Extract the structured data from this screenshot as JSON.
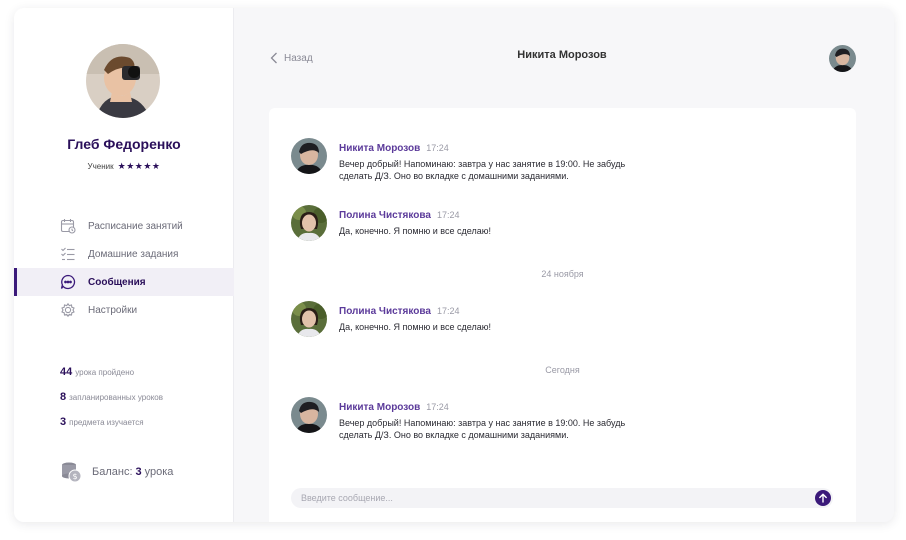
{
  "profile": {
    "name": "Глеб Федоренко",
    "role": "Ученик",
    "stars": "★★★★★"
  },
  "nav": {
    "items": [
      {
        "label": "Расписание занятий",
        "icon": "calendar-icon"
      },
      {
        "label": "Домашние задания",
        "icon": "checklist-icon"
      },
      {
        "label": "Сообщения",
        "icon": "chat-bubble-icon",
        "active": true
      },
      {
        "label": "Настройки",
        "icon": "gear-icon"
      }
    ]
  },
  "stats": [
    {
      "value": "44",
      "label": "урока пройдено"
    },
    {
      "value": "8",
      "label": "запланированных уроков"
    },
    {
      "value": "3",
      "label": "предмета изучается"
    }
  ],
  "balance": {
    "prefix": "Баланс:",
    "value": "3",
    "suffix": "урока"
  },
  "header": {
    "back_label": "Назад",
    "title": "Никита Морозов"
  },
  "messages": [
    {
      "author": "Никита Морозов",
      "time": "17:24",
      "text": "Вечер добрый! Напоминаю: завтра у нас занятие в 19:00. Не забудь сделать Д/З. Оно во вкладке с домашними заданиями."
    },
    {
      "author": "Полина Чистякова",
      "time": "17:24",
      "text": "Да, конечно. Я помню и все сделаю!"
    },
    {
      "author": "Полина Чистякова",
      "time": "17:24",
      "text": "Да, конечно. Я помню и все сделаю!"
    },
    {
      "author": "Никита Морозов",
      "time": "17:24",
      "text": "Вечер добрый! Напоминаю: завтра у нас занятие в 19:00. Не забудь сделать Д/З. Оно во вкладке с домашними заданиями."
    }
  ],
  "date_separators": [
    "24 ноября",
    "Сегодня"
  ],
  "composer": {
    "placeholder": "Введите сообщение..."
  },
  "colors": {
    "accent": "#3b1a7a",
    "author": "#5b3a9a",
    "heading": "#2a0f5a"
  }
}
